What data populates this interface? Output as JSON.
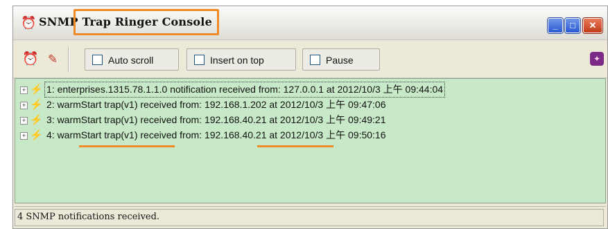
{
  "window": {
    "title_prefix": "SNMP",
    "title_main": "Trap Ringer Console",
    "icons": {
      "app": "alarm-clock-icon",
      "minimize": "minimize-icon",
      "maximize": "maximize-icon",
      "close": "close-icon"
    },
    "caption_glyphs": {
      "minimize": "_",
      "maximize": "□",
      "close": "✕"
    }
  },
  "toolbar": {
    "alarm_glyph": "⏰",
    "brush_glyph": "✎",
    "auto_scroll_label": "Auto scroll",
    "insert_on_top_label": "Insert on top",
    "pause_label": "Pause",
    "right_glyph": "✦"
  },
  "events": {
    "expand_glyph": "+",
    "trap_glyph": "⚡",
    "rows": [
      {
        "text": "1: enterprises.1315.78.1.1.0 notification received from: 127.0.0.1 at 2012/10/3 上午 09:44:04",
        "selected": true
      },
      {
        "text": "2: warmStart trap(v1) received from: 192.168.1.202 at 2012/10/3 上午 09:47:06",
        "selected": false
      },
      {
        "text": "3: warmStart trap(v1) received from: 192.168.40.21 at 2012/10/3 上午 09:49:21",
        "selected": false
      },
      {
        "text": "4: warmStart trap(v1) received from: 192.168.40.21 at 2012/10/3 上午 09:50:16",
        "selected": false
      }
    ]
  },
  "status": {
    "text": "4 SNMP notifications received."
  },
  "colors": {
    "highlight": "#f08a24",
    "events_background": "#c7e9c7",
    "window_background": "#ece9d8"
  }
}
